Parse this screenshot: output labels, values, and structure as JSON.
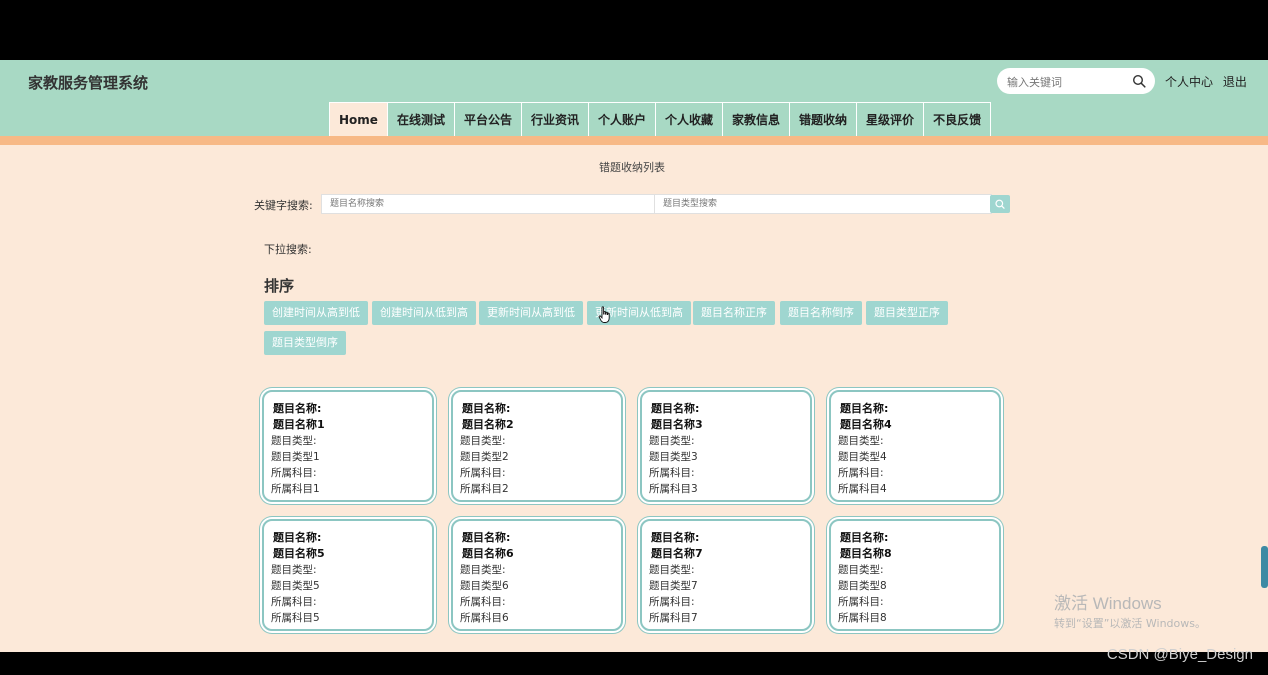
{
  "app": {
    "title": "家教服务管理系统"
  },
  "header": {
    "search_placeholder": "输入关键词",
    "user_center": "个人中心",
    "logout": "退出"
  },
  "nav": [
    "Home",
    "在线测试",
    "平台公告",
    "行业资讯",
    "个人账户",
    "个人收藏",
    "家教信息",
    "错题收纳",
    "星级评价",
    "不良反馈"
  ],
  "nav_active_index": 0,
  "page": {
    "list_title": "错题收纳列表",
    "keyword_label": "关键字搜索:",
    "name_placeholder": "题目名称搜索",
    "type_placeholder": "题目类型搜索",
    "dropdown_label": "下拉搜索:",
    "sort_title": "排序",
    "sort_buttons": [
      "创建时间从高到低",
      "创建时间从低到高",
      "更新时间从高到低",
      "更新时间从低到高",
      "题目名称正序",
      "题目名称倒序",
      "题目类型正序",
      "题目类型倒序"
    ]
  },
  "cards": [
    {
      "name_label": "题目名称:",
      "name": "题目名称1",
      "type_label": "题目类型:",
      "type": "题目类型1",
      "subject_label": "所属科目:",
      "subject": "所属科目1"
    },
    {
      "name_label": "题目名称:",
      "name": "题目名称2",
      "type_label": "题目类型:",
      "type": "题目类型2",
      "subject_label": "所属科目:",
      "subject": "所属科目2"
    },
    {
      "name_label": "题目名称:",
      "name": "题目名称3",
      "type_label": "题目类型:",
      "type": "题目类型3",
      "subject_label": "所属科目:",
      "subject": "所属科目3"
    },
    {
      "name_label": "题目名称:",
      "name": "题目名称4",
      "type_label": "题目类型:",
      "type": "题目类型4",
      "subject_label": "所属科目:",
      "subject": "所属科目4"
    },
    {
      "name_label": "题目名称:",
      "name": "题目名称5",
      "type_label": "题目类型:",
      "type": "题目类型5",
      "subject_label": "所属科目:",
      "subject": "所属科目5"
    },
    {
      "name_label": "题目名称:",
      "name": "题目名称6",
      "type_label": "题目类型:",
      "type": "题目类型6",
      "subject_label": "所属科目:",
      "subject": "所属科目6"
    },
    {
      "name_label": "题目名称:",
      "name": "题目名称7",
      "type_label": "题目类型:",
      "type": "题目类型7",
      "subject_label": "所属科目:",
      "subject": "所属科目7"
    },
    {
      "name_label": "题目名称:",
      "name": "题目名称8",
      "type_label": "题目类型:",
      "type": "题目类型8",
      "subject_label": "所属科目:",
      "subject": "所属科目8"
    }
  ],
  "os": {
    "activation_title": "激活 Windows",
    "activation_sub": "转到“设置”以激活 Windows。",
    "csdn_watermark": "CSDN @Biye_Design"
  },
  "colors": {
    "header": "#a8d9c4",
    "stripe": "#f7b986",
    "page_bg": "#fce9d9",
    "accent_button": "#9fd6d0",
    "card_border": "#8cc6c2"
  },
  "icons": {
    "search": "search-icon",
    "cursor": "hand-cursor-icon"
  }
}
